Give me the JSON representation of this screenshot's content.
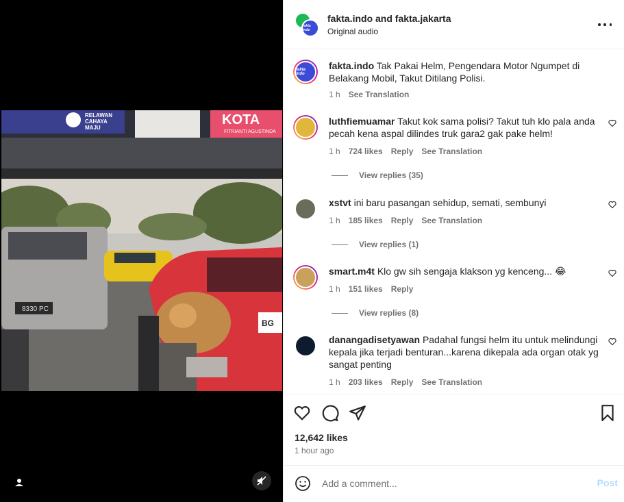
{
  "header": {
    "title": "fakta.indo and fakta.jakarta",
    "subtitle": "Original audio",
    "avatar_text": "fakta indo",
    "more_icon": "more-horizontal-icon"
  },
  "video": {
    "billboard_left": "RELAWAN CAHAYA MAJU",
    "billboard_right": "KOTA",
    "billboard_name": "FITRIANTI AGUSTINDA",
    "plate_left": "BG 8330 PC",
    "plate_right": "BG"
  },
  "caption": {
    "user": "fakta.indo",
    "text": "Tak Pakai Helm, Pengendara Motor Ngumpet di Belakang Mobil, Takut Ditilang Polisi.",
    "time": "1 h",
    "translate": "See Translation"
  },
  "comments": [
    {
      "user": "luthfiemuamar",
      "text": "Takut kok sama polisi? Takut tuh klo pala anda pecah kena aspal dilindes truk gara2 gak pake helm!",
      "time": "1 h",
      "likes": "724 likes",
      "reply": "Reply",
      "translate": "See Translation",
      "view_replies": "View replies (35)"
    },
    {
      "user": "xstvt",
      "text": "ini baru pasangan sehidup, semati, sembunyi",
      "time": "1 h",
      "likes": "185 likes",
      "reply": "Reply",
      "translate": "See Translation",
      "view_replies": "View replies (1)"
    },
    {
      "user": "smart.m4t",
      "text": "Klo gw sih sengaja klakson yg kenceng... 😂",
      "time": "1 h",
      "likes": "151 likes",
      "reply": "Reply",
      "view_replies": "View replies (8)"
    },
    {
      "user": "danangadisetyawan",
      "text": "Padahal fungsi helm itu untuk melindungi kepala jika terjadi benturan...karena dikepala ada organ otak yg sangat penting",
      "time": "1 h",
      "likes": "203 likes",
      "reply": "Reply",
      "translate": "See Translation"
    }
  ],
  "actions": {
    "likes": "12,642 likes",
    "time": "1 hour ago"
  },
  "add_comment": {
    "placeholder": "Add a comment...",
    "post": "Post"
  },
  "colors": {
    "accent_post": "#b3dbff",
    "secondary_text": "#737373",
    "primary_text": "#262626"
  }
}
